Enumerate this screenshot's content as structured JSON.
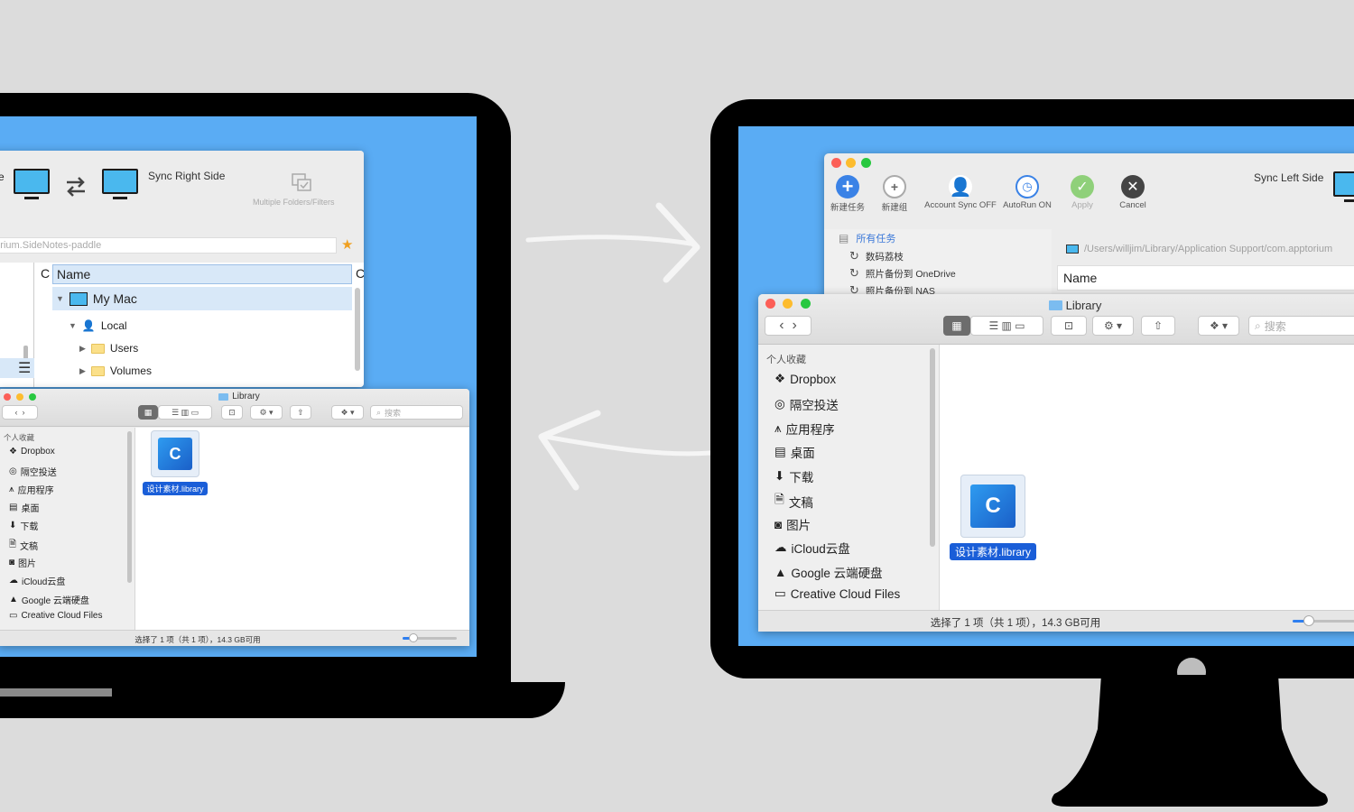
{
  "laptop": {
    "sync_app": {
      "sync_label": "Sync Right Side",
      "multi_label": "Multiple Folders/Filters",
      "path_text": "ptorium.SideNotes-paddle",
      "col_c": "C",
      "col_name": "Name",
      "col_c2": "C",
      "tree": {
        "mymac": "My Mac",
        "local": "Local",
        "users": "Users",
        "volumes": "Volumes"
      },
      "left_frag": "e"
    },
    "finder": {
      "title": "Library",
      "section": "个人收藏",
      "search_placeholder": "搜索",
      "sidebar": [
        "Dropbox",
        "隔空投送",
        "应用程序",
        "桌面",
        "下载",
        "文稿",
        "图片",
        "iCloud云盘",
        "Google 云端硬盘",
        "Creative Cloud Files"
      ],
      "file_label": "设计素材.library",
      "status": "选择了 1 项（共 1 项），14.3 GB可用",
      "zoom_level": 0.2
    }
  },
  "monitor": {
    "sync_app": {
      "toolbar": [
        {
          "label": "新建任务",
          "icon": "plus-circle-icon",
          "color": "#3a82e6"
        },
        {
          "label": "新建组",
          "icon": "group-add-icon",
          "color": "#8a8a8a"
        },
        {
          "label": "Account Sync OFF",
          "icon": "account-icon",
          "color": "#3a82e6"
        },
        {
          "label": "AutoRun ON",
          "icon": "clock-icon",
          "color": "#3a82e6"
        },
        {
          "label": "Apply",
          "icon": "check-circle-icon",
          "color": "#8fd07a"
        },
        {
          "label": "Cancel",
          "icon": "x-circle-icon",
          "color": "#444444"
        }
      ],
      "sync_label": "Sync Left Side",
      "all_tasks": "所有任务",
      "tasks": [
        "数码荔枝",
        "照片备份到 OneDrive",
        "照片备份到 NAS"
      ],
      "path_text": "/Users/willjim/Library/Application Support/com.apptorium",
      "col_name": "Name"
    },
    "finder": {
      "title": "Library",
      "section": "个人收藏",
      "search_placeholder": "搜索",
      "sidebar": [
        "Dropbox",
        "隔空投送",
        "应用程序",
        "桌面",
        "下载",
        "文稿",
        "图片",
        "iCloud云盘",
        "Google 云端硬盘",
        "Creative Cloud Files"
      ],
      "file_label": "设计素材.library",
      "status": "选择了 1 项（共 1 项），14.3 GB可用",
      "zoom_level": 0.2
    }
  },
  "colors": {
    "screen_blue": "#5aacf4",
    "selection_blue": "#1a5ed8",
    "monitor_icon": "#4ab8ee"
  }
}
